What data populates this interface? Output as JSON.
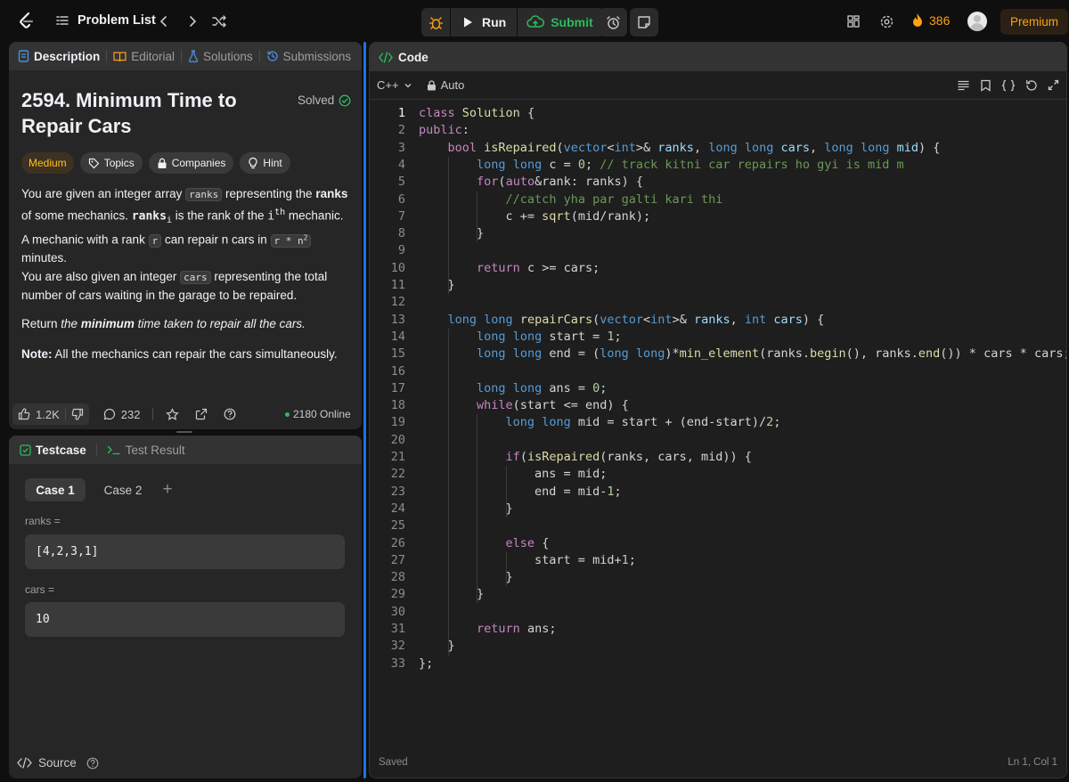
{
  "topbar": {
    "problem_list_label": "Problem List",
    "run_label": "Run",
    "submit_label": "Submit",
    "streak_count": "386",
    "premium_label": "Premium",
    "colors": {
      "accent": "#ffa116",
      "submit_green": "#2cbb5d"
    }
  },
  "left_panel": {
    "tabs": [
      {
        "label": "Description",
        "icon": "document-icon"
      },
      {
        "label": "Editorial",
        "icon": "book-icon"
      },
      {
        "label": "Solutions",
        "icon": "flask-icon"
      },
      {
        "label": "Submissions",
        "icon": "history-icon"
      }
    ],
    "problem": {
      "title_line1": "2594. Minimum Time to",
      "title_line2": "Repair Cars",
      "status": "Solved",
      "difficulty": "Medium",
      "tags": [
        "Topics",
        "Companies",
        "Hint"
      ],
      "p1": {
        "a": "You are given an integer array ",
        "code1": "ranks",
        "b": " representing the ",
        "bold1": "ranks",
        "c": " of some mechanics. ",
        "var": "ranks",
        "sub": "i",
        "d": " is the rank of the ",
        "i": "i",
        "sup": "th",
        "e": " mechanic. A mechanic with a rank ",
        "code2": "r",
        "f": " can repair n cars in ",
        "code3": "r * n",
        "sup2": "2",
        "g": " minutes."
      },
      "p2": {
        "a": "You are also given an integer ",
        "code": "cars",
        "b": " representing the total number of cars waiting in the garage to be repaired."
      },
      "p3": {
        "a": "Return ",
        "b": "the ",
        "bold": "minimum",
        "c": " time taken to repair all the cars."
      },
      "p4": {
        "bold": "Note:",
        "a": " All the mechanics can repair the cars simultaneously."
      }
    },
    "footer": {
      "likes": "1.2K",
      "comments": "232",
      "online": "2180 Online"
    }
  },
  "testcase_panel": {
    "tabs": [
      {
        "label": "Testcase",
        "icon": "checkbox-icon"
      },
      {
        "label": "Test Result",
        "icon": "terminal-icon"
      }
    ],
    "cases": [
      "Case 1",
      "Case 2"
    ],
    "add_label": "+",
    "params": [
      {
        "label": "ranks =",
        "value": "[4,2,3,1]"
      },
      {
        "label": "cars =",
        "value": "10"
      }
    ],
    "source_label": "Source"
  },
  "code_panel": {
    "title": "Code",
    "language": "C++",
    "mode": "Auto",
    "status_left": "Saved",
    "status_right": "Ln 1, Col 1",
    "line_numbers": [
      "1",
      "2",
      "3",
      "4",
      "5",
      "6",
      "7",
      "8",
      "9",
      "10",
      "11",
      "12",
      "13",
      "14",
      "15",
      "16",
      "17",
      "18",
      "19",
      "20",
      "21",
      "22",
      "23",
      "24",
      "25",
      "26",
      "27",
      "28",
      "29",
      "30",
      "31",
      "32",
      "33"
    ],
    "lines": [
      "class Solution {",
      "public:",
      "    bool isRepaired(vector<int>& ranks, long long cars, long long mid) {",
      "        long long c = 0; // track kitni car repairs ho gyi is mid m",
      "        for(auto&rank: ranks) {",
      "            //catch yha par galti kari thi",
      "            c += sqrt(mid/rank);",
      "        }",
      "",
      "        return c >= cars;",
      "    }",
      "",
      "    long long repairCars(vector<int>& ranks, int cars) {",
      "        long long start = 1;",
      "        long long end = (long long)*min_element(ranks.begin(), ranks.end()) * cars * cars;",
      "",
      "        long long ans = 0;",
      "        while(start <= end) {",
      "            long long mid = start + (end-start)/2;",
      "",
      "            if(isRepaired(ranks, cars, mid)) {",
      "                ans = mid;",
      "                end = mid-1;",
      "            }",
      "",
      "            else {",
      "                start = mid+1;",
      "            }",
      "        }",
      "",
      "        return ans;",
      "    }",
      "};"
    ]
  }
}
